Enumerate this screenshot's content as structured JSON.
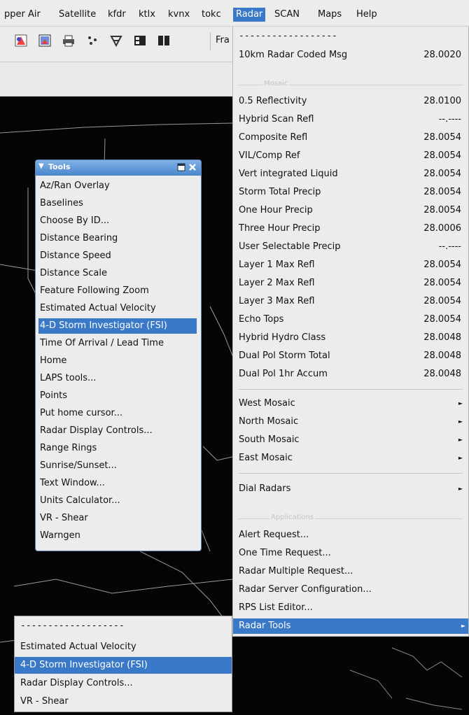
{
  "menubar": {
    "items": [
      "pper Air",
      "Satellite",
      "kfdr",
      "ktlx",
      "kvnx",
      "tokc",
      "Radar",
      "SCAN",
      "Maps",
      "Help"
    ],
    "active": "Radar"
  },
  "toolbar": {
    "frame_label_partial": "Fra",
    "icons": [
      "color-map-icon",
      "image-properties-icon",
      "print-icon",
      "scatter-points-icon",
      "pan-tool-icon",
      "panel-layout-icon",
      "dual-panel-icon"
    ]
  },
  "radar_menu": {
    "tear_off": "------------------",
    "coded_msg": {
      "label": "10km Radar Coded Msg",
      "value": "28.0020"
    },
    "mosaic_header": "Mosaic",
    "mosaic_items": [
      {
        "label": "0.5 Reflectivity",
        "value": "28.0100"
      },
      {
        "label": "Hybrid Scan Refl",
        "value": "--.----"
      },
      {
        "label": "Composite Refl",
        "value": "28.0054"
      },
      {
        "label": "VIL/Comp Ref",
        "value": "28.0054"
      },
      {
        "label": "Vert integrated Liquid",
        "value": "28.0054"
      },
      {
        "label": "Storm Total Precip",
        "value": "28.0054"
      },
      {
        "label": "One Hour Precip",
        "value": "28.0054"
      },
      {
        "label": "Three Hour Precip",
        "value": "28.0006"
      },
      {
        "label": "User Selectable Precip",
        "value": "--.----"
      },
      {
        "label": "Layer 1 Max Refl",
        "value": "28.0054"
      },
      {
        "label": "Layer 2 Max Refl",
        "value": "28.0054"
      },
      {
        "label": "Layer 3 Max Refl",
        "value": "28.0054"
      },
      {
        "label": "Echo Tops",
        "value": "28.0054"
      },
      {
        "label": "Hybrid Hydro Class",
        "value": "28.0048"
      },
      {
        "label": "Dual Pol Storm Total",
        "value": "28.0048"
      },
      {
        "label": "Dual Pol 1hr Accum",
        "value": "28.0048"
      }
    ],
    "sub_mosaics": [
      "West Mosaic",
      "North Mosaic",
      "South Mosaic",
      "East Mosaic"
    ],
    "dial_radars": "Dial Radars",
    "applications_header": "Applications",
    "applications": [
      "Alert Request...",
      "One Time Request...",
      "Radar Multiple Request...",
      "Radar Server Configuration...",
      "RPS List Editor..."
    ],
    "radar_tools": "Radar Tools"
  },
  "tools_window": {
    "title": "Tools",
    "items": [
      "Az/Ran Overlay",
      "Baselines",
      "Choose By ID...",
      "Distance Bearing",
      "Distance Speed",
      "Distance Scale",
      "Feature Following Zoom",
      "Estimated Actual Velocity",
      "4-D Storm Investigator (FSI)",
      "Time Of Arrival / Lead Time",
      "Home",
      "LAPS tools...",
      "Points",
      "Put home cursor...",
      "Radar Display Controls...",
      "Range Rings",
      "Sunrise/Sunset...",
      "Text Window...",
      "Units Calculator...",
      "VR - Shear",
      "Warngen"
    ],
    "highlighted": "4-D Storm Investigator (FSI)"
  },
  "popup": {
    "tear_off": "-------------------",
    "items": [
      "Estimated Actual Velocity",
      "4-D Storm Investigator (FSI)",
      "Radar Display Controls...",
      "VR - Shear"
    ],
    "highlighted": "4-D Storm Investigator (FSI)"
  },
  "colors": {
    "highlight": "#3a79c8",
    "menu_bg": "#ececec",
    "map_bg": "#050505",
    "title_bar": "#4a86cc"
  }
}
